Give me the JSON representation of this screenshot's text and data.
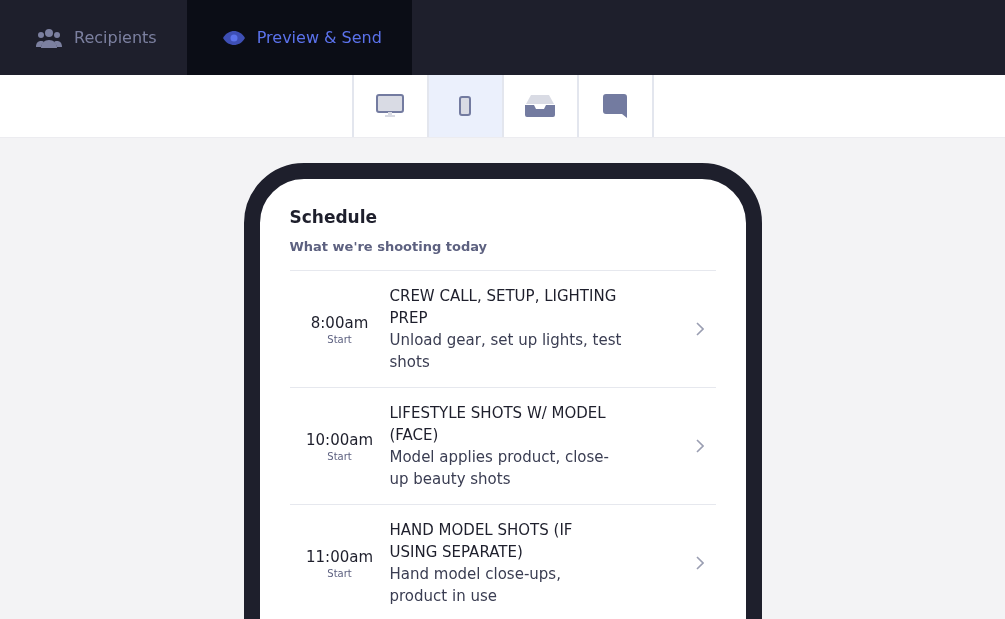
{
  "nav_tabs": [
    {
      "label": "Recipients",
      "kind": "users",
      "selected": false
    },
    {
      "label": "Preview & Send",
      "kind": "eye",
      "selected": true
    }
  ],
  "device_tabs": [
    {
      "kind": "monitor",
      "selected": false
    },
    {
      "kind": "phone",
      "selected": true
    },
    {
      "kind": "inbox",
      "selected": false
    },
    {
      "kind": "chat",
      "selected": false
    }
  ],
  "preview": {
    "title": "Schedule",
    "subtitle": "What we're shooting today",
    "items": [
      {
        "time": "8:00am",
        "time_label": "Start",
        "title": "CREW CALL, SETUP, LIGHTING PREP",
        "description": "Unload gear, set up lights, test shots"
      },
      {
        "time": "10:00am",
        "time_label": "Start",
        "title": "LIFESTYLE SHOTS W/ MODEL (FACE)",
        "description": "Model applies product, close-up beauty shots"
      },
      {
        "time": "11:00am",
        "time_label": "Start",
        "title": "HAND MODEL SHOTS (IF USING SEPARATE)",
        "description": "Hand model close-ups, product in use"
      }
    ]
  }
}
